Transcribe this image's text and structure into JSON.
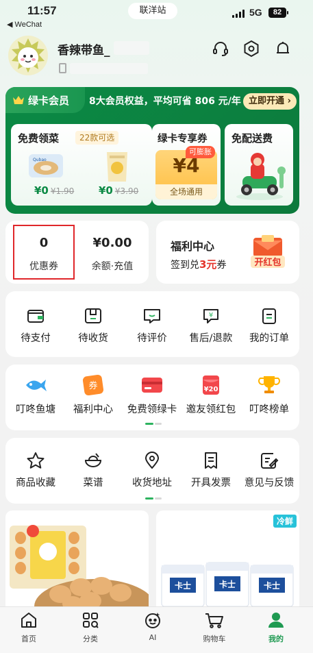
{
  "status_bar": {
    "time": "11:57",
    "back_app": "◀ WeChat",
    "network": "5G",
    "battery": "82",
    "station": "联洋站"
  },
  "profile": {
    "username": "香辣带鱼_"
  },
  "member": {
    "badge": "绿卡会员",
    "desc_prefix": "8大会员权益，平均可省",
    "desc_amount": "806",
    "desc_suffix": "元/年",
    "open_button": "立即开通 ›",
    "free_veg": {
      "title": "免费领菜",
      "sub": "22款可选",
      "items": [
        {
          "now": "¥0",
          "was": "¥1.90"
        },
        {
          "now": "¥0",
          "was": "¥3.90"
        }
      ]
    },
    "coupon": {
      "title": "绿卡专享券",
      "tag": "可膨胀",
      "value": "¥4",
      "foot": "全场通用"
    },
    "delivery": {
      "title": "免配送费"
    }
  },
  "wallet": {
    "coupons_count": "0",
    "coupons_label": "优惠券",
    "balance": "¥0.00",
    "balance_label": "余额·充值",
    "welfare_title": "福利中心",
    "welfare_sub_prefix": "签到兑",
    "welfare_sub_amount": "3元",
    "welfare_sub_suffix": "券",
    "redpack_label": "开红包"
  },
  "orders": [
    {
      "label": "待支付",
      "icon": "wallet-icon"
    },
    {
      "label": "待收货",
      "icon": "box-icon"
    },
    {
      "label": "待评价",
      "icon": "comment-icon"
    },
    {
      "label": "售后/退款",
      "icon": "refund-icon"
    },
    {
      "label": "我的订单",
      "icon": "order-list-icon"
    }
  ],
  "services": [
    {
      "label": "叮咚鱼塘",
      "icon": "fish-icon"
    },
    {
      "label": "福利中心",
      "icon": "coupon-icon"
    },
    {
      "label": "免费领绿卡",
      "icon": "card-icon"
    },
    {
      "label": "邀友领红包",
      "icon": "redpacket-icon"
    },
    {
      "label": "叮咚榜单",
      "icon": "trophy-icon"
    }
  ],
  "tools": [
    {
      "label": "商品收藏",
      "icon": "star-icon"
    },
    {
      "label": "菜谱",
      "icon": "recipe-bowl-icon"
    },
    {
      "label": "收货地址",
      "icon": "location-icon"
    },
    {
      "label": "开具发票",
      "icon": "invoice-icon"
    },
    {
      "label": "意见与反馈",
      "icon": "feedback-icon"
    }
  ],
  "products": {
    "fresh_tag": "冷鲜",
    "yogurt_brand": "卡士"
  },
  "tabbar": [
    {
      "label": "首页",
      "icon": "home-icon"
    },
    {
      "label": "分类",
      "icon": "category-icon"
    },
    {
      "label": "AI",
      "icon": "ai-icon"
    },
    {
      "label": "购物车",
      "icon": "cart-icon"
    },
    {
      "label": "我的",
      "icon": "profile-icon"
    }
  ],
  "colors": {
    "brand_green": "#0c8a45",
    "accent_red": "#e4332a",
    "highlight_red": "#e0262a"
  }
}
